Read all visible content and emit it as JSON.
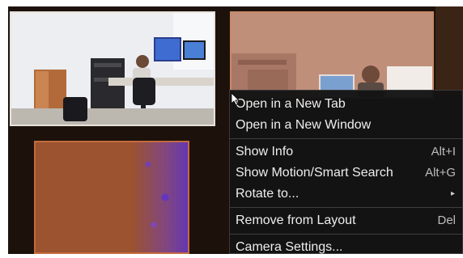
{
  "context_menu": {
    "items": [
      {
        "label": "Open in a New Tab",
        "shortcut": ""
      },
      {
        "label": "Open in a New Window",
        "shortcut": ""
      },
      {
        "label": "Show Info",
        "shortcut": "Alt+I"
      },
      {
        "label": "Show Motion/Smart Search",
        "shortcut": "Alt+G"
      },
      {
        "label": "Rotate to...",
        "shortcut": "",
        "submenu": true
      },
      {
        "label": "Remove from Layout",
        "shortcut": "Del"
      },
      {
        "label": "Camera Settings...",
        "shortcut": ""
      }
    ],
    "submenu_arrow": "▸"
  },
  "colors": {
    "viewer_background": "#1c120b",
    "menu_background": "#141414",
    "menu_text": "#eeeeee",
    "shortcut_text": "#bdbdbd"
  },
  "icons": {
    "cursor": "mouse-pointer-icon",
    "submenu": "chevron-right-icon"
  }
}
